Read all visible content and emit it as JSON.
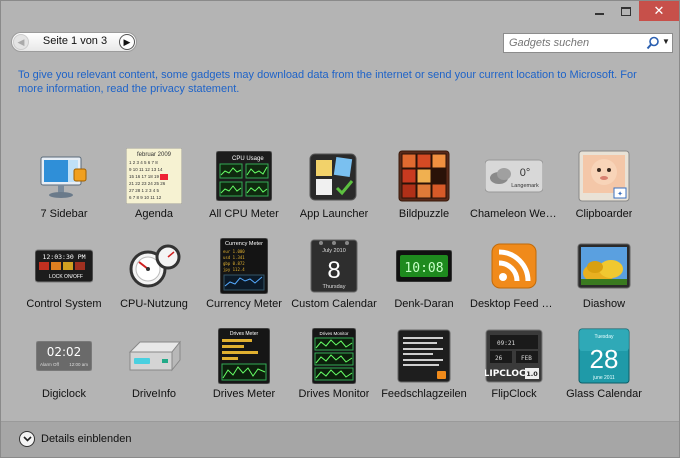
{
  "titlebar": {
    "minimize": "minimize",
    "maximize": "maximize",
    "close": "✕"
  },
  "pager": {
    "label": "Seite 1 von 3"
  },
  "search": {
    "placeholder": "Gadgets suchen"
  },
  "privacy_notice": "To give you relevant content, some gadgets may download data from the internet or send your current location to Microsoft. For more information, read the privacy statement.",
  "gadgets": [
    {
      "name": "7 Sidebar",
      "icon": "monitor-sidebar-icon"
    },
    {
      "name": "Agenda",
      "icon": "calendar-month-icon",
      "text": "februar 2009"
    },
    {
      "name": "All CPU Meter",
      "icon": "cpu-meter-icon",
      "text": "CPU Usage"
    },
    {
      "name": "App Launcher",
      "icon": "app-launcher-icon"
    },
    {
      "name": "Bildpuzzle",
      "icon": "picture-puzzle-icon"
    },
    {
      "name": "Chameleon Wea...",
      "icon": "weather-cloud-icon",
      "text": "0°",
      "subtext": "Langemark"
    },
    {
      "name": "Clipboarder",
      "icon": "baby-photo-icon"
    },
    {
      "name": "Control System",
      "icon": "control-system-icon",
      "text": "12:03:30 PM",
      "subtext": "LOCK ON/OFF"
    },
    {
      "name": "CPU-Nutzung",
      "icon": "cpu-gauge-icon"
    },
    {
      "name": "Currency Meter",
      "icon": "currency-meter-icon",
      "text": "Currency Meter"
    },
    {
      "name": "Custom Calendar",
      "icon": "calendar-day-icon",
      "text": "8",
      "subtext": "July 2010",
      "subtext2": "Thursday"
    },
    {
      "name": "Denk-Daran",
      "icon": "digital-clock-green-icon",
      "text": "10:08"
    },
    {
      "name": "Desktop Feed R...",
      "icon": "rss-feed-icon"
    },
    {
      "name": "Diashow",
      "icon": "slideshow-icon"
    },
    {
      "name": "Digiclock",
      "icon": "digiclock-icon",
      "text": "02:02",
      "subtext": "Alarm Off",
      "subtext2": "12:00 am"
    },
    {
      "name": "DriveInfo",
      "icon": "drive-info-icon"
    },
    {
      "name": "Drives Meter",
      "icon": "drives-meter-icon",
      "text": "Drives Meter"
    },
    {
      "name": "Drives Monitor",
      "icon": "drives-monitor-icon",
      "text": "Drives Monitor"
    },
    {
      "name": "Feedschlagzeilen",
      "icon": "feed-headlines-icon"
    },
    {
      "name": "FlipClock",
      "icon": "flip-clock-icon",
      "text": "FLIPCLOCK",
      "subtext": "1.0"
    },
    {
      "name": "Glass Calendar",
      "icon": "glass-calendar-icon",
      "text": "28",
      "subtext": "Tuesday",
      "subtext2": "june 2011"
    }
  ],
  "footer": {
    "details_label": "Details einblenden"
  }
}
